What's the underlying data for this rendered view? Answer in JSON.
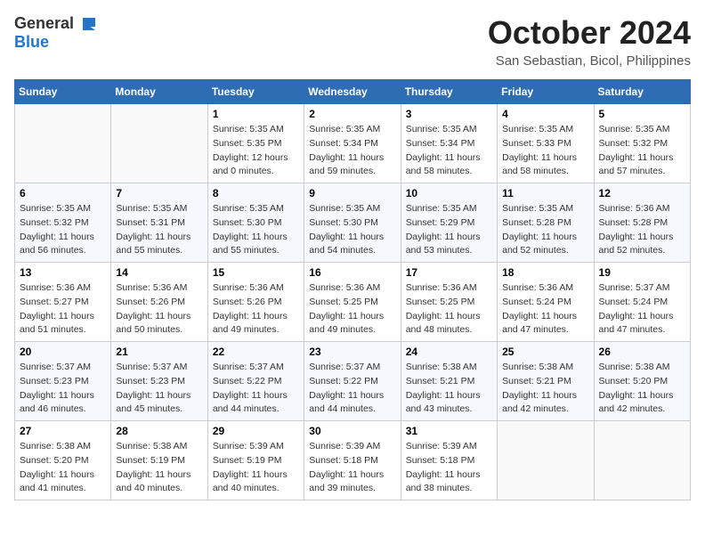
{
  "logo": {
    "general": "General",
    "blue": "Blue"
  },
  "header": {
    "month": "October 2024",
    "location": "San Sebastian, Bicol, Philippines"
  },
  "weekdays": [
    "Sunday",
    "Monday",
    "Tuesday",
    "Wednesday",
    "Thursday",
    "Friday",
    "Saturday"
  ],
  "weeks": [
    [
      {
        "day": "",
        "info": ""
      },
      {
        "day": "",
        "info": ""
      },
      {
        "day": "1",
        "info": "Sunrise: 5:35 AM\nSunset: 5:35 PM\nDaylight: 12 hours\nand 0 minutes."
      },
      {
        "day": "2",
        "info": "Sunrise: 5:35 AM\nSunset: 5:34 PM\nDaylight: 11 hours\nand 59 minutes."
      },
      {
        "day": "3",
        "info": "Sunrise: 5:35 AM\nSunset: 5:34 PM\nDaylight: 11 hours\nand 58 minutes."
      },
      {
        "day": "4",
        "info": "Sunrise: 5:35 AM\nSunset: 5:33 PM\nDaylight: 11 hours\nand 58 minutes."
      },
      {
        "day": "5",
        "info": "Sunrise: 5:35 AM\nSunset: 5:32 PM\nDaylight: 11 hours\nand 57 minutes."
      }
    ],
    [
      {
        "day": "6",
        "info": "Sunrise: 5:35 AM\nSunset: 5:32 PM\nDaylight: 11 hours\nand 56 minutes."
      },
      {
        "day": "7",
        "info": "Sunrise: 5:35 AM\nSunset: 5:31 PM\nDaylight: 11 hours\nand 55 minutes."
      },
      {
        "day": "8",
        "info": "Sunrise: 5:35 AM\nSunset: 5:30 PM\nDaylight: 11 hours\nand 55 minutes."
      },
      {
        "day": "9",
        "info": "Sunrise: 5:35 AM\nSunset: 5:30 PM\nDaylight: 11 hours\nand 54 minutes."
      },
      {
        "day": "10",
        "info": "Sunrise: 5:35 AM\nSunset: 5:29 PM\nDaylight: 11 hours\nand 53 minutes."
      },
      {
        "day": "11",
        "info": "Sunrise: 5:35 AM\nSunset: 5:28 PM\nDaylight: 11 hours\nand 52 minutes."
      },
      {
        "day": "12",
        "info": "Sunrise: 5:36 AM\nSunset: 5:28 PM\nDaylight: 11 hours\nand 52 minutes."
      }
    ],
    [
      {
        "day": "13",
        "info": "Sunrise: 5:36 AM\nSunset: 5:27 PM\nDaylight: 11 hours\nand 51 minutes."
      },
      {
        "day": "14",
        "info": "Sunrise: 5:36 AM\nSunset: 5:26 PM\nDaylight: 11 hours\nand 50 minutes."
      },
      {
        "day": "15",
        "info": "Sunrise: 5:36 AM\nSunset: 5:26 PM\nDaylight: 11 hours\nand 49 minutes."
      },
      {
        "day": "16",
        "info": "Sunrise: 5:36 AM\nSunset: 5:25 PM\nDaylight: 11 hours\nand 49 minutes."
      },
      {
        "day": "17",
        "info": "Sunrise: 5:36 AM\nSunset: 5:25 PM\nDaylight: 11 hours\nand 48 minutes."
      },
      {
        "day": "18",
        "info": "Sunrise: 5:36 AM\nSunset: 5:24 PM\nDaylight: 11 hours\nand 47 minutes."
      },
      {
        "day": "19",
        "info": "Sunrise: 5:37 AM\nSunset: 5:24 PM\nDaylight: 11 hours\nand 47 minutes."
      }
    ],
    [
      {
        "day": "20",
        "info": "Sunrise: 5:37 AM\nSunset: 5:23 PM\nDaylight: 11 hours\nand 46 minutes."
      },
      {
        "day": "21",
        "info": "Sunrise: 5:37 AM\nSunset: 5:23 PM\nDaylight: 11 hours\nand 45 minutes."
      },
      {
        "day": "22",
        "info": "Sunrise: 5:37 AM\nSunset: 5:22 PM\nDaylight: 11 hours\nand 44 minutes."
      },
      {
        "day": "23",
        "info": "Sunrise: 5:37 AM\nSunset: 5:22 PM\nDaylight: 11 hours\nand 44 minutes."
      },
      {
        "day": "24",
        "info": "Sunrise: 5:38 AM\nSunset: 5:21 PM\nDaylight: 11 hours\nand 43 minutes."
      },
      {
        "day": "25",
        "info": "Sunrise: 5:38 AM\nSunset: 5:21 PM\nDaylight: 11 hours\nand 42 minutes."
      },
      {
        "day": "26",
        "info": "Sunrise: 5:38 AM\nSunset: 5:20 PM\nDaylight: 11 hours\nand 42 minutes."
      }
    ],
    [
      {
        "day": "27",
        "info": "Sunrise: 5:38 AM\nSunset: 5:20 PM\nDaylight: 11 hours\nand 41 minutes."
      },
      {
        "day": "28",
        "info": "Sunrise: 5:38 AM\nSunset: 5:19 PM\nDaylight: 11 hours\nand 40 minutes."
      },
      {
        "day": "29",
        "info": "Sunrise: 5:39 AM\nSunset: 5:19 PM\nDaylight: 11 hours\nand 40 minutes."
      },
      {
        "day": "30",
        "info": "Sunrise: 5:39 AM\nSunset: 5:18 PM\nDaylight: 11 hours\nand 39 minutes."
      },
      {
        "day": "31",
        "info": "Sunrise: 5:39 AM\nSunset: 5:18 PM\nDaylight: 11 hours\nand 38 minutes."
      },
      {
        "day": "",
        "info": ""
      },
      {
        "day": "",
        "info": ""
      }
    ]
  ]
}
